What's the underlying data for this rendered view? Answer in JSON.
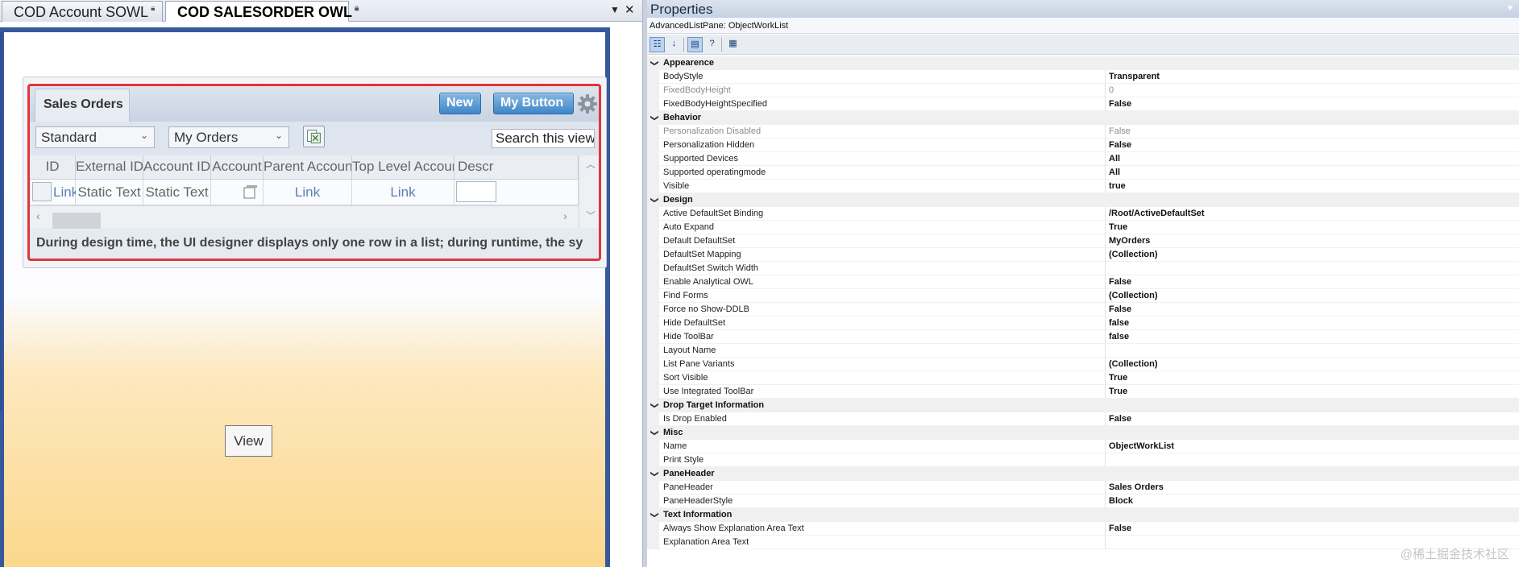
{
  "tabs": [
    {
      "label": "COD Account SOWL",
      "active": false
    },
    {
      "label": "COD SALESORDER OWL",
      "active": true
    }
  ],
  "tab_controls": {
    "dropdown": "▼",
    "close": "✕"
  },
  "pane": {
    "title": "Sales Orders",
    "buttons": {
      "new": "New",
      "my": "My Button"
    },
    "gear_icon": "gear-icon",
    "default_set": "Standard",
    "query": "My Orders",
    "search": "Search this view",
    "columns": [
      "ID",
      "External ID",
      "Account ID",
      "Account",
      "Parent Account",
      "Top Level Account",
      "Descr"
    ],
    "row": [
      "Link",
      "Static Text",
      "Static Text",
      "",
      "Link",
      "Link",
      ""
    ],
    "explanation": "During design time, the UI designer displays only one row in a list; during runtime, the sy"
  },
  "view_button": "View",
  "properties": {
    "title": "Properties",
    "object": "AdvancedListPane: ObjectWorkList",
    "toolbar": [
      "categorized-icon",
      "alphabetical-icon",
      "properties-icon",
      "help-icon",
      "pages-icon"
    ],
    "categories": [
      {
        "name": "Appearence",
        "props": [
          {
            "name": "BodyStyle",
            "value": "Transparent"
          },
          {
            "name": "FixedBodyHeight",
            "value": "0",
            "dim": true
          },
          {
            "name": "FixedBodyHeightSpecified",
            "value": "False"
          }
        ]
      },
      {
        "name": "Behavior",
        "props": [
          {
            "name": "Personalization Disabled",
            "value": "False",
            "dim": true
          },
          {
            "name": "Personalization Hidden",
            "value": "False"
          },
          {
            "name": "Supported Devices",
            "value": "All"
          },
          {
            "name": "Supported operatingmode",
            "value": "All"
          },
          {
            "name": "Visible",
            "value": "true"
          }
        ]
      },
      {
        "name": "Design",
        "props": [
          {
            "name": "Active DefaultSet Binding",
            "value": "/Root/ActiveDefaultSet"
          },
          {
            "name": "Auto Expand",
            "value": "True"
          },
          {
            "name": "Default DefaultSet",
            "value": "MyOrders"
          },
          {
            "name": "DefaultSet Mapping",
            "value": "(Collection)"
          },
          {
            "name": "DefaultSet Switch Width",
            "value": ""
          },
          {
            "name": "Enable Analytical OWL",
            "value": "False"
          },
          {
            "name": "Find Forms",
            "value": "(Collection)"
          },
          {
            "name": "Force no Show-DDLB",
            "value": "False"
          },
          {
            "name": "Hide DefaultSet",
            "value": "false"
          },
          {
            "name": "Hide ToolBar",
            "value": "false"
          },
          {
            "name": "Layout Name",
            "value": ""
          },
          {
            "name": "List Pane Variants",
            "value": "(Collection)"
          },
          {
            "name": "Sort Visible",
            "value": "True"
          },
          {
            "name": "Use Integrated ToolBar",
            "value": "True"
          }
        ]
      },
      {
        "name": "Drop Target Information",
        "props": [
          {
            "name": "Is Drop Enabled",
            "value": "False"
          }
        ]
      },
      {
        "name": "Misc",
        "props": [
          {
            "name": "Name",
            "value": "ObjectWorkList"
          },
          {
            "name": "Print Style",
            "value": ""
          }
        ]
      },
      {
        "name": "PaneHeader",
        "props": [
          {
            "name": "PaneHeader",
            "value": "Sales Orders"
          },
          {
            "name": "PaneHeaderStyle",
            "value": "Block"
          }
        ]
      },
      {
        "name": "Text Information",
        "props": [
          {
            "name": "Always Show Explanation Area Text",
            "value": "False"
          },
          {
            "name": "Explanation Area Text",
            "value": ""
          }
        ]
      }
    ]
  },
  "watermark": "@稀土掘金技术社区",
  "colors": {
    "selection_border": "#e0353b",
    "button_blue": "#3f86c8",
    "frame_blue": "#38589c"
  }
}
